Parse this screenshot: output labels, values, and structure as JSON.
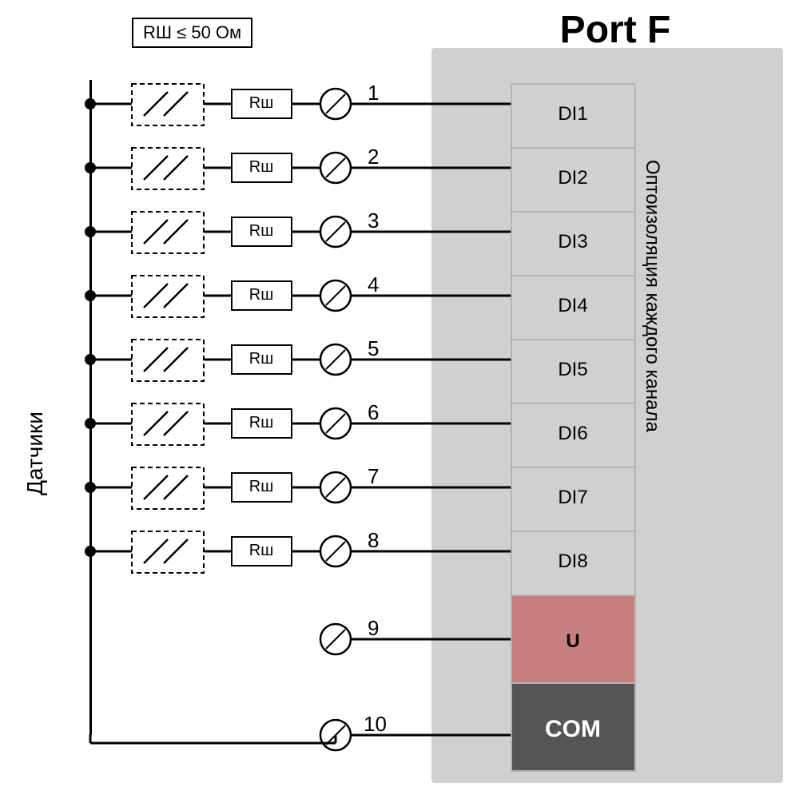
{
  "title": "Port F",
  "labels": {
    "sensors": "Датчики",
    "opto": "Оптоизоляция каждого канала",
    "rsh_limit": "RШ ≤ 50 Ом",
    "rsh": "Rш",
    "u": "U",
    "com": "COM"
  },
  "rows": [
    {
      "num": "1",
      "di": "DI1"
    },
    {
      "num": "2",
      "di": "DI2"
    },
    {
      "num": "3",
      "di": "DI3"
    },
    {
      "num": "4",
      "di": "DI4"
    },
    {
      "num": "5",
      "di": "DI5"
    },
    {
      "num": "6",
      "di": "DI6"
    },
    {
      "num": "7",
      "di": "DI7"
    },
    {
      "num": "8",
      "di": "DI8"
    }
  ],
  "special_rows": [
    {
      "num": "9",
      "label": "U",
      "type": "u"
    },
    {
      "num": "10",
      "label": "COM",
      "type": "com"
    }
  ],
  "colors": {
    "panel_bg": "#d0d0d0",
    "u_bg": "#c87f7f",
    "com_bg": "#555555",
    "com_text": "#ffffff"
  }
}
